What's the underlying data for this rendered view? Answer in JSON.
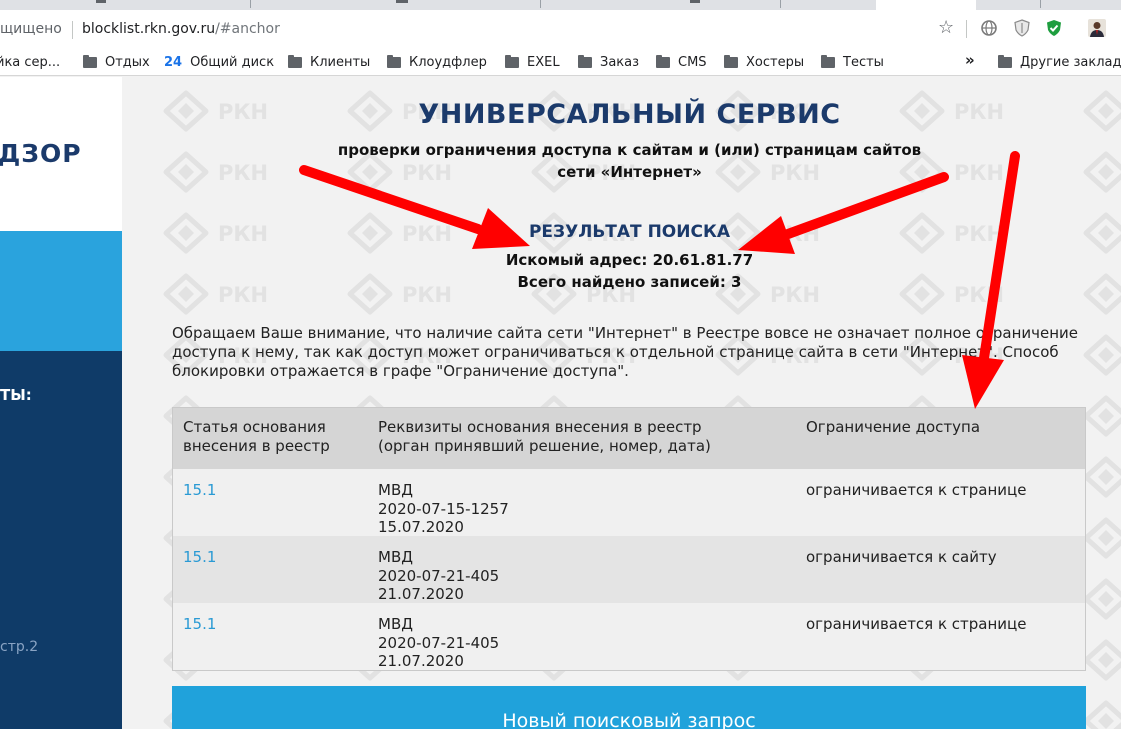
{
  "browser": {
    "security_text": "щищено",
    "url_host": "blocklist.rkn.gov.ru",
    "url_path": "/#anchor",
    "bookmarks": [
      {
        "label": "йка сер...",
        "icon": "none"
      },
      {
        "label": "Отдых",
        "icon": "folder-icon"
      },
      {
        "label": "Общий диск",
        "icon": "24"
      },
      {
        "label": "Клиенты",
        "icon": "folder-icon"
      },
      {
        "label": "Клоудфлер",
        "icon": "folder-icon"
      },
      {
        "label": "EXEL",
        "icon": "folder-icon"
      },
      {
        "label": "Заказ",
        "icon": "folder-icon"
      },
      {
        "label": "CMS",
        "icon": "folder-icon"
      },
      {
        "label": "Хостеры",
        "icon": "folder-icon"
      },
      {
        "label": "Тесты",
        "icon": "folder-icon"
      }
    ],
    "bookmarks_overflow": "»",
    "other_bookmarks": "Другие заклад",
    "badge_24": "24"
  },
  "sidebar": {
    "logo_text": "ДЗОР",
    "nav_label": "ТЫ:",
    "nav_link": "стр.2"
  },
  "main": {
    "title": "УНИВЕРСАЛЬНЫЙ СЕРВИС",
    "subtitle_line1": "проверки ограничения доступа к сайтам и (или) страницам сайтов",
    "subtitle_line2": "сети «Интернет»",
    "result_heading": "РЕЗУЛЬТАТ ПОИСКА",
    "searched_address": "Искомый адрес: 20.61.81.77",
    "total_found": "Всего найдено записей: 3",
    "notice": "Обращаем Ваше внимание, что наличие сайта сети \"Интернет\" в Реестре вовсе не означает полное ограничение доступа к нему, так как доступ может ограничиваться к отдельной странице сайта в сети \"Интернет\". Способ блокировки отражается в графе \"Ограничение доступа\".",
    "new_search_button": "Новый поисковый запрос",
    "watermark_text": "РКН"
  },
  "table": {
    "headers": [
      [
        "Статья основания",
        "внесения в реестр"
      ],
      [
        "Реквизиты основания внесения в реестр",
        "(орган принявший решение, номер, дата)"
      ],
      [
        "Ограничение доступа"
      ]
    ],
    "rows": [
      {
        "article": "15.1",
        "authority": "МВД",
        "number": "2020-07-15-1257",
        "date": "15.07.2020",
        "restriction": "ограничивается к странице"
      },
      {
        "article": "15.1",
        "authority": "МВД",
        "number": "2020-07-21-405",
        "date": "21.07.2020",
        "restriction": "ограничивается к сайту"
      },
      {
        "article": "15.1",
        "authority": "МВД",
        "number": "2020-07-21-405",
        "date": "21.07.2020",
        "restriction": "ограничивается к странице"
      }
    ]
  },
  "colors": {
    "brand_dark": "#1b3a6b",
    "accent_blue": "#20a2db",
    "annotation_red": "#ff0000"
  }
}
